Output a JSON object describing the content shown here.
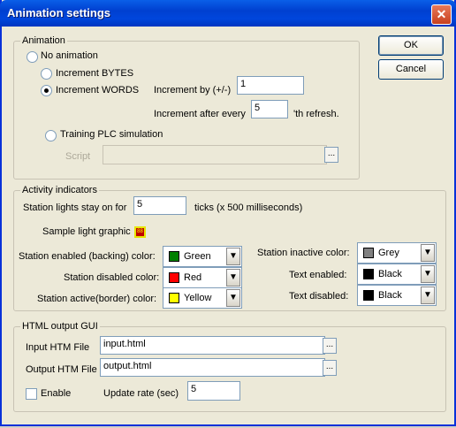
{
  "window": {
    "title": "Animation settings",
    "close_label": "✕"
  },
  "buttons": {
    "ok": "OK",
    "cancel": "Cancel"
  },
  "animation": {
    "legend": "Animation",
    "no_animation": "No animation",
    "increment_bytes": "Increment BYTES",
    "increment_words": "Increment WORDS",
    "increment_by_label": "Increment by (+/-)",
    "increment_by_value": "1",
    "increment_after_label": "Increment after every",
    "increment_after_value": "5",
    "refresh_suffix": "'th refresh.",
    "training_plc": "Training PLC simulation",
    "script_label": "Script",
    "script_value": "",
    "selected": "increment_words"
  },
  "activity": {
    "legend": "Activity indicators",
    "lights_label": "Station lights stay on for",
    "lights_value": "5",
    "ticks_label": "ticks (x 500 milliseconds)",
    "sample_label": "Sample light graphic",
    "sample_text": "88",
    "enabled_label": "Station enabled (backing) color:",
    "enabled_value": "Green",
    "enabled_color": "#008000",
    "disabled_label": "Station disabled color:",
    "disabled_value": "Red",
    "disabled_color": "#ff0000",
    "active_label": "Station active(border) color:",
    "active_value": "Yellow",
    "active_color": "#ffff00",
    "inactive_label": "Station inactive color:",
    "inactive_value": "Grey",
    "inactive_color": "#808080",
    "text_enabled_label": "Text enabled:",
    "text_enabled_value": "Black",
    "text_enabled_color": "#000000",
    "text_disabled_label": "Text disabled:",
    "text_disabled_value": "Black",
    "text_disabled_color": "#000000"
  },
  "html_gui": {
    "legend": "HTML output GUI",
    "input_label": "Input HTM File",
    "input_value": "input.html",
    "output_label": "Output HTM File",
    "output_value": "output.html",
    "enable_label": "Enable",
    "enable_checked": false,
    "update_label": "Update rate (sec)",
    "update_value": "5"
  }
}
